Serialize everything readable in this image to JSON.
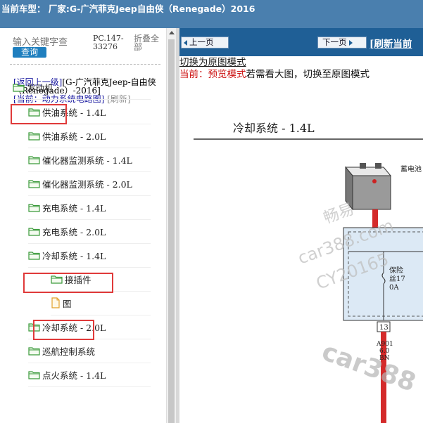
{
  "header": {
    "title": "当前车型：  厂家:G-广汽菲克Jeep自由侠（Renegade）2016"
  },
  "search": {
    "placeholder": "输入关键字查",
    "button": "查询",
    "pc_code": "PC.147-33276",
    "collapse_all": "折叠全部"
  },
  "nav": {
    "back": "[返回上一级]",
    "back_target": "[G-广汽菲克Jeep-自由侠（Renegade）-2016]",
    "current": "[当前：动力系统电路图]",
    "refresh": "[刷新]"
  },
  "tree": [
    {
      "label": "发动机",
      "type": "folder",
      "highlighted": true
    },
    {
      "label": "供油系统 - 1.4L",
      "type": "folder"
    },
    {
      "label": "供油系统 - 2.0L",
      "type": "folder"
    },
    {
      "label": "催化器监测系统 - 1.4L",
      "type": "folder"
    },
    {
      "label": "催化器监测系统 - 2.0L",
      "type": "folder"
    },
    {
      "label": "充电系统 - 1.4L",
      "type": "folder"
    },
    {
      "label": "充电系统 - 2.0L",
      "type": "folder"
    },
    {
      "label": "冷却系统 - 1.4L",
      "type": "folder",
      "highlighted": true
    },
    {
      "label": "接插件",
      "type": "folder"
    },
    {
      "label": "图",
      "type": "file",
      "highlighted": true
    },
    {
      "label": "冷却系统 - 2.0L",
      "type": "folder"
    },
    {
      "label": "巡航控制系统",
      "type": "folder"
    },
    {
      "label": "点火系统 - 1.4L",
      "type": "folder"
    }
  ],
  "toolbar": {
    "prev": "上一页",
    "next": "下一页",
    "refresh_current": "[刷新当前"
  },
  "viewer": {
    "switch_link": "切换为原图模式",
    "mode_prefix": "当前：",
    "mode_name": "预览模式",
    "mode_hint": "若需看大图，切换至原图模式"
  },
  "diagram": {
    "title": "冷却系统 - 1.4L",
    "battery_label": "蓄电池",
    "fuse_label_1": "保险",
    "fuse_label_2": "丝17",
    "fuse_rating": "0A",
    "connector_pin": "13",
    "wire_code": "A901",
    "wire_gauge": "6.0",
    "wire_color": "BN",
    "watermark_1": "畅易",
    "watermark_2": "car388.com",
    "watermark_3": "CY20165",
    "watermark_4": "car388"
  },
  "colors": {
    "header_bg": "#4a7fae",
    "toolbar_bg": "#1f5f96",
    "highlight_border": "#e03a3a",
    "folder_green": "#3a9a3a",
    "wire_red": "#d42a2a",
    "module_fill": "#dce9f5"
  }
}
